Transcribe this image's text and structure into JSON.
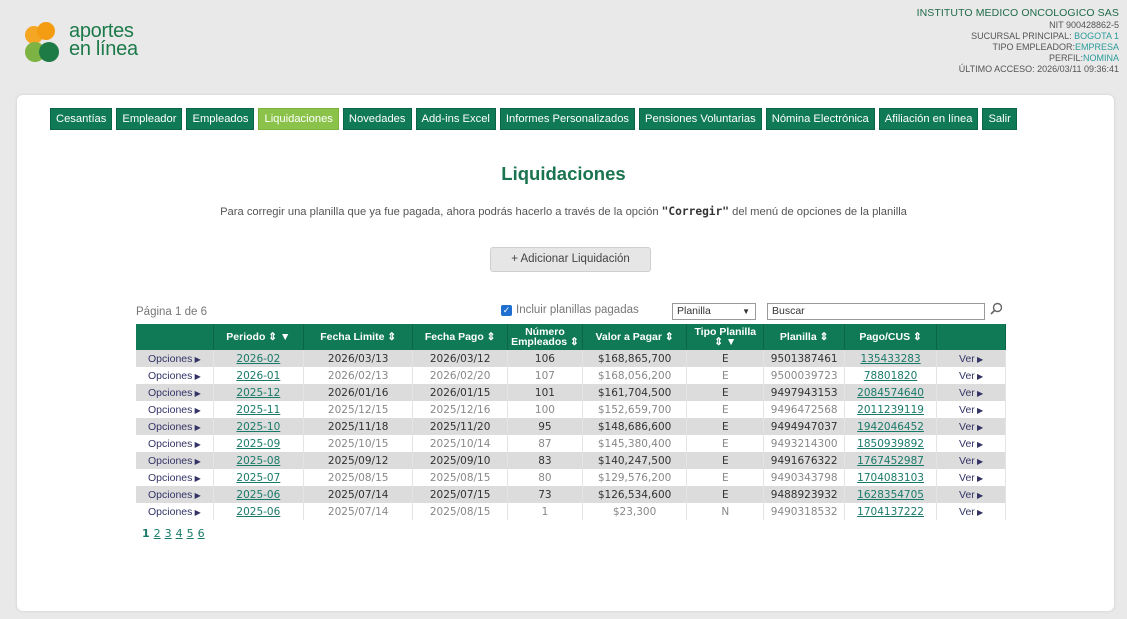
{
  "logo": {
    "line1": "aportes",
    "line2": "en línea"
  },
  "company": {
    "name": "INSTITUTO MEDICO ONCOLOGICO SAS",
    "nit": "NIT 900428862-5",
    "sucursal_label": "SUCURSAL PRINCIPAL:",
    "sucursal_value": "BOGOTA 1",
    "tipo_label": "TIPO EMPLEADOR:",
    "tipo_value": "EMPRESA",
    "perfil_label": "PERFIL:",
    "perfil_value": "NOMINA",
    "acceso": "ÚLTIMO ACCESO: 2026/03/11 09:36:41"
  },
  "nav": [
    {
      "label": "Cesantías",
      "name": "tab-cesantias"
    },
    {
      "label": "Empleador",
      "name": "tab-empleador"
    },
    {
      "label": "Empleados",
      "name": "tab-empleados"
    },
    {
      "label": "Liquidaciones",
      "name": "tab-liquidaciones",
      "active": true
    },
    {
      "label": "Novedades",
      "name": "tab-novedades"
    },
    {
      "label": "Add-ins Excel",
      "name": "tab-addins-excel"
    },
    {
      "label": "Informes Personalizados",
      "name": "tab-informes-personalizados"
    },
    {
      "label": "Pensiones Voluntarias",
      "name": "tab-pensiones-voluntarias"
    },
    {
      "label": "Nómina Electrónica",
      "name": "tab-nomina-electronica"
    },
    {
      "label": "Afiliación en línea",
      "name": "tab-afiliacion-en-linea"
    },
    {
      "label": "Salir",
      "name": "tab-salir"
    }
  ],
  "page": {
    "title": "Liquidaciones",
    "notice_pre": "Para corregir una planilla que ya fue pagada, ahora podrás hacerlo a través de la opción ",
    "notice_bold": "\"Corregir\"",
    "notice_post": " del menú de opciones de la planilla",
    "add_button": "+ Adicionar Liquidación",
    "page_info": "Página 1 de 6",
    "include_paid": "Incluir planillas pagadas",
    "filter_select": "Planilla",
    "search_placeholder": "Buscar"
  },
  "table": {
    "headers": [
      "",
      "Periodo ⇕ ▼",
      "Fecha Limite ⇕",
      "Fecha Pago ⇕",
      "Número Empleados ⇕",
      "Valor a Pagar ⇕",
      "Tipo Planilla ⇕ ▼",
      "Planilla ⇕",
      "Pago/CUS ⇕",
      ""
    ],
    "rows": [
      {
        "ops": "Opciones",
        "periodo": "2026-02",
        "limite": "2026/03/13",
        "pago": "2026/03/12",
        "empleados": "106",
        "valor": "$168,865,700",
        "tipo": "E",
        "planilla": "9501387461",
        "cus": "135433283",
        "ver": "Ver"
      },
      {
        "ops": "Opciones",
        "periodo": "2026-01",
        "limite": "2026/02/13",
        "pago": "2026/02/20",
        "empleados": "107",
        "valor": "$168,056,200",
        "tipo": "E",
        "planilla": "9500039723",
        "cus": "78801820",
        "ver": "Ver"
      },
      {
        "ops": "Opciones",
        "periodo": "2025-12",
        "limite": "2026/01/16",
        "pago": "2026/01/15",
        "empleados": "101",
        "valor": "$161,704,500",
        "tipo": "E",
        "planilla": "9497943153",
        "cus": "2084574640",
        "ver": "Ver"
      },
      {
        "ops": "Opciones",
        "periodo": "2025-11",
        "limite": "2025/12/15",
        "pago": "2025/12/16",
        "empleados": "100",
        "valor": "$152,659,700",
        "tipo": "E",
        "planilla": "9496472568",
        "cus": "2011239119",
        "ver": "Ver"
      },
      {
        "ops": "Opciones",
        "periodo": "2025-10",
        "limite": "2025/11/18",
        "pago": "2025/11/20",
        "empleados": "95",
        "valor": "$148,686,600",
        "tipo": "E",
        "planilla": "9494947037",
        "cus": "1942046452",
        "ver": "Ver"
      },
      {
        "ops": "Opciones",
        "periodo": "2025-09",
        "limite": "2025/10/15",
        "pago": "2025/10/14",
        "empleados": "87",
        "valor": "$145,380,400",
        "tipo": "E",
        "planilla": "9493214300",
        "cus": "1850939892",
        "ver": "Ver"
      },
      {
        "ops": "Opciones",
        "periodo": "2025-08",
        "limite": "2025/09/12",
        "pago": "2025/09/10",
        "empleados": "83",
        "valor": "$140,247,500",
        "tipo": "E",
        "planilla": "9491676322",
        "cus": "1767452987",
        "ver": "Ver"
      },
      {
        "ops": "Opciones",
        "periodo": "2025-07",
        "limite": "2025/08/15",
        "pago": "2025/08/15",
        "empleados": "80",
        "valor": "$129,576,200",
        "tipo": "E",
        "planilla": "9490343798",
        "cus": "1704083103",
        "ver": "Ver"
      },
      {
        "ops": "Opciones",
        "periodo": "2025-06",
        "limite": "2025/07/14",
        "pago": "2025/07/15",
        "empleados": "73",
        "valor": "$126,534,600",
        "tipo": "E",
        "planilla": "9488923932",
        "cus": "1628354705",
        "ver": "Ver"
      },
      {
        "ops": "Opciones",
        "periodo": "2025-06",
        "limite": "2025/07/14",
        "pago": "2025/08/15",
        "empleados": "1",
        "valor": "$23,300",
        "tipo": "N",
        "planilla": "9490318532",
        "cus": "1704137222",
        "ver": "Ver"
      }
    ]
  },
  "pager": [
    "1",
    "2",
    "3",
    "4",
    "5",
    "6"
  ],
  "colors": {
    "primary": "#0f7a55",
    "active_tab": "#8bc34a",
    "link": "#1a7a6a"
  }
}
